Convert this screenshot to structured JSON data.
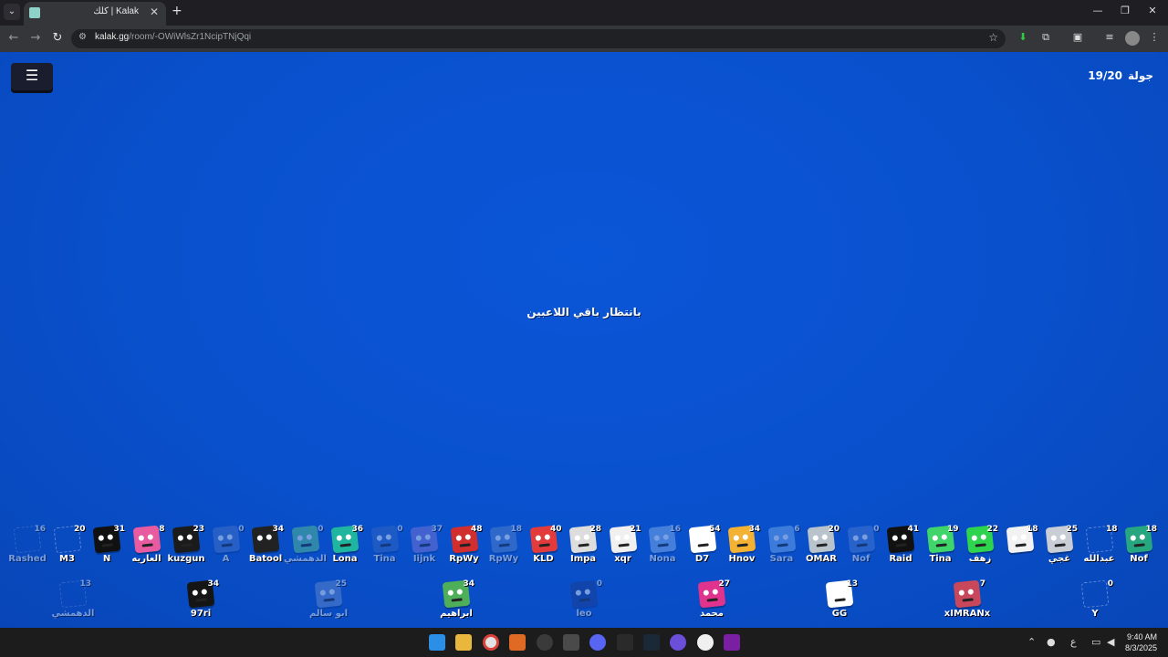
{
  "browser": {
    "tab_title": "كلك | Kalak",
    "url_host": "kalak.gg",
    "url_path": "/room/-OWiWlsZr1NcipTNjQqi"
  },
  "game": {
    "round_label": "جولة",
    "round_value": "19/20",
    "status": "بانتظار باقي اللاعبين"
  },
  "players_row1": [
    {
      "name": "Rashed",
      "score": "16",
      "color": "#3a5fb8",
      "faded": true,
      "empty": true
    },
    {
      "name": "M3",
      "score": "20",
      "color": "#3a5fb8",
      "faded": false,
      "empty": true
    },
    {
      "name": "N",
      "score": "31",
      "color": "#111111",
      "faded": false,
      "empty": false
    },
    {
      "name": "العاريه",
      "score": "8",
      "color": "#e85ba0",
      "faded": false,
      "empty": false
    },
    {
      "name": "kuzgun",
      "score": "23",
      "color": "#1b1b1b",
      "faded": false,
      "empty": false
    },
    {
      "name": "A",
      "score": "0",
      "color": "#4a76c8",
      "faded": true,
      "empty": false
    },
    {
      "name": "Batool",
      "score": "34",
      "color": "#222222",
      "faded": false,
      "empty": false
    },
    {
      "name": "الدهمشي",
      "score": "0",
      "color": "#5fcf8a",
      "faded": true,
      "empty": false
    },
    {
      "name": "Lona",
      "score": "36",
      "color": "#1fb59f",
      "faded": false,
      "empty": false
    },
    {
      "name": "Tina",
      "score": "0",
      "color": "#3769bf",
      "faded": true,
      "empty": false
    },
    {
      "name": "Iijnk",
      "score": "37",
      "color": "#8a79d8",
      "faded": true,
      "empty": false
    },
    {
      "name": "RpWy",
      "score": "48",
      "color": "#d12f2f",
      "faded": false,
      "empty": false
    },
    {
      "name": "RpWy",
      "score": "18",
      "color": "#5b86c8",
      "faded": true,
      "empty": false
    },
    {
      "name": "KLD",
      "score": "40",
      "color": "#e33b3b",
      "faded": false,
      "empty": false
    },
    {
      "name": "Impa",
      "score": "28",
      "color": "#dddddd",
      "faded": false,
      "empty": false
    },
    {
      "name": "xqr",
      "score": "21",
      "color": "#f0f0f0",
      "faded": false,
      "empty": false
    },
    {
      "name": "Nona",
      "score": "16",
      "color": "#8fb8f0",
      "faded": true,
      "empty": false
    },
    {
      "name": "D7",
      "score": "54",
      "color": "#ffffff",
      "faded": false,
      "empty": false
    },
    {
      "name": "Hnov",
      "score": "34",
      "color": "#f3b233",
      "faded": false,
      "empty": false
    },
    {
      "name": "Sara",
      "score": "6",
      "color": "#7ab2f0",
      "faded": true,
      "empty": false
    },
    {
      "name": "OMAR",
      "score": "20",
      "color": "#b9c3cc",
      "faded": false,
      "empty": false
    },
    {
      "name": "Nof",
      "score": "0",
      "color": "#4f7cd0",
      "faded": true,
      "empty": false
    },
    {
      "name": "Raid",
      "score": "41",
      "color": "#111111",
      "faded": false,
      "empty": false
    },
    {
      "name": "Tina",
      "score": "19",
      "color": "#3fd56b",
      "faded": false,
      "empty": false
    },
    {
      "name": "زهف",
      "score": "22",
      "color": "#2fd44e",
      "faded": false,
      "empty": false
    },
    {
      "name": "",
      "score": "18",
      "color": "#f2f2f2",
      "faded": false,
      "empty": false
    },
    {
      "name": "غجي",
      "score": "25",
      "color": "#c9ced6",
      "faded": false,
      "empty": false
    },
    {
      "name": "عبدالله",
      "score": "18",
      "color": "#3a5fb8",
      "faded": false,
      "empty": true
    },
    {
      "name": "Nof",
      "score": "18",
      "color": "#27a77f",
      "faded": false,
      "empty": false
    }
  ],
  "players_row2": [
    {
      "name": "الدهمشي",
      "score": "13",
      "color": "#3a5fb8",
      "faded": true,
      "empty": true
    },
    {
      "name": "97ri",
      "score": "34",
      "color": "#151515",
      "faded": false,
      "empty": false
    },
    {
      "name": "ابو سالم",
      "score": "25",
      "color": "#6e8fce",
      "faded": true,
      "empty": false
    },
    {
      "name": "ابراهيم",
      "score": "34",
      "color": "#4fae5a",
      "faded": false,
      "empty": false
    },
    {
      "name": "leo",
      "score": "0",
      "color": "#1d3b8a",
      "faded": true,
      "empty": false
    },
    {
      "name": "محمد",
      "score": "27",
      "color": "#e0338e",
      "faded": false,
      "empty": false
    },
    {
      "name": "GG",
      "score": "13",
      "color": "#ffffff",
      "faded": false,
      "empty": false
    },
    {
      "name": "xIMRANx",
      "score": "7",
      "color": "#c8475b",
      "faded": false,
      "empty": false
    },
    {
      "name": "Y",
      "score": "0",
      "color": "#3a5fb8",
      "faded": false,
      "empty": true
    }
  ],
  "taskbar": {
    "time": "9:40 AM",
    "date": "8/3/2025",
    "lang": "ع"
  }
}
